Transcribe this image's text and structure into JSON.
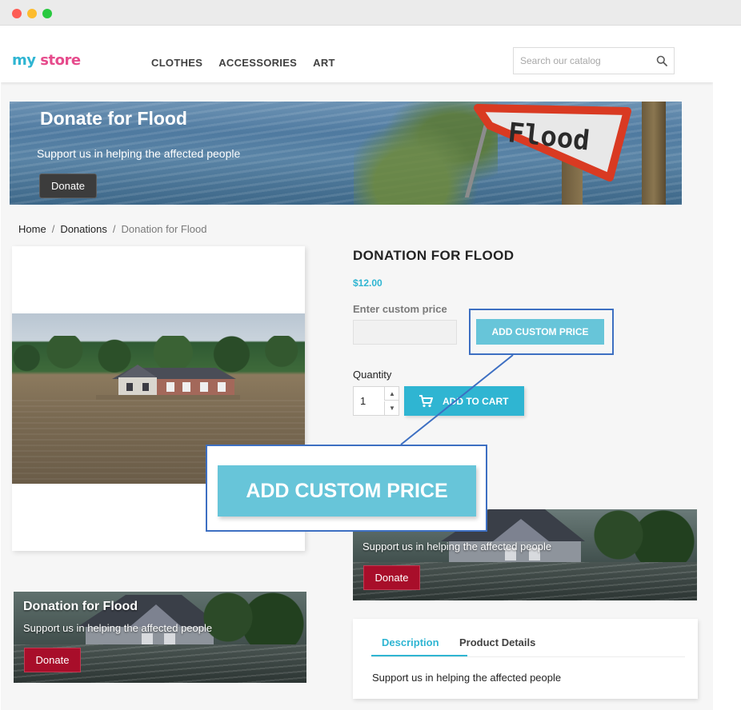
{
  "logo": {
    "part1": "my",
    "part2": " ",
    "part3": "store"
  },
  "nav": {
    "items": [
      "CLOTHES",
      "ACCESSORIES",
      "ART"
    ]
  },
  "search": {
    "placeholder": "Search our catalog"
  },
  "banner": {
    "title": "Donate for Flood",
    "subtitle": "Support us in helping the affected people",
    "button": "Donate",
    "sign_text": "Flood"
  },
  "breadcrumb": {
    "home": "Home",
    "category": "Donations",
    "current": "Donation for Flood"
  },
  "product": {
    "title": "DONATION FOR FLOOD",
    "price": "$12.00",
    "custom_price_label": "Enter custom price",
    "custom_price_button": "ADD CUSTOM PRICE",
    "quantity_label": "Quantity",
    "quantity_value": "1",
    "add_to_cart": "ADD TO CART"
  },
  "callout": {
    "button": "ADD CUSTOM PRICE"
  },
  "promo_right": {
    "subtitle": "Support us in helping the affected people",
    "button": "Donate"
  },
  "promo_left": {
    "title": "Donation for Flood",
    "subtitle": "Support us in helping the affected people",
    "button": "Donate"
  },
  "tabs": {
    "description": "Description",
    "details": "Product Details",
    "content": "Support us in helping the affected people"
  },
  "colors": {
    "accent": "#2fb5d2",
    "custom_button": "#67c5d9",
    "highlight": "#3d6fc2",
    "donate_red": "#a80e2a"
  }
}
